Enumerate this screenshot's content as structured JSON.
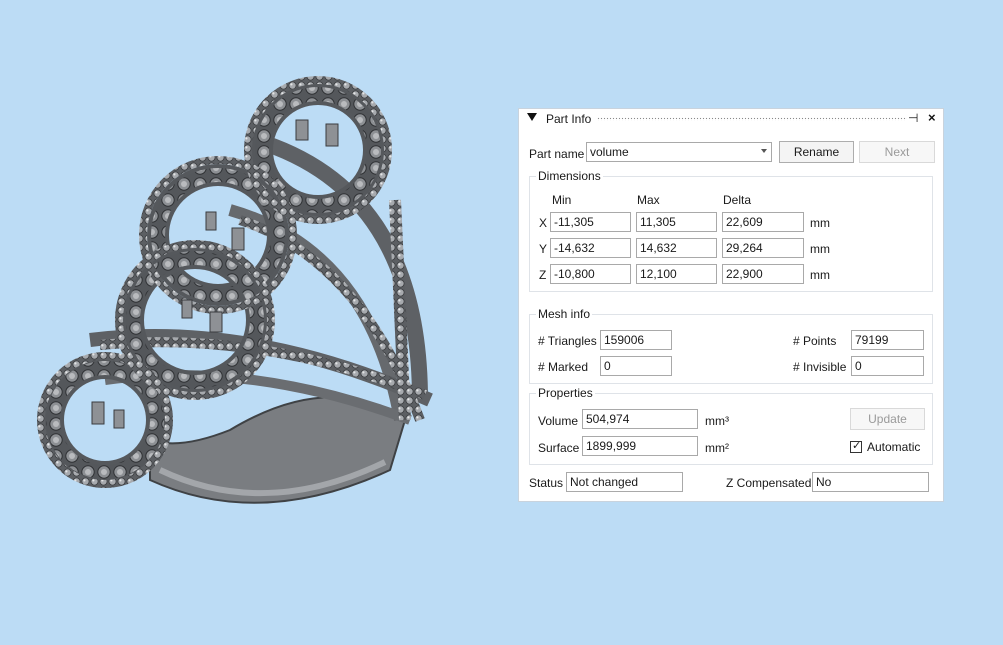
{
  "panel": {
    "title": "Part Info",
    "pin_glyph": "⊣",
    "close_glyph": "×"
  },
  "part": {
    "label": "Part name",
    "value": "volume",
    "rename": "Rename",
    "next": "Next"
  },
  "dimensions": {
    "title": "Dimensions",
    "headers": [
      "Min",
      "Max",
      "Delta"
    ],
    "unit": "mm",
    "rows": [
      {
        "axis": "X",
        "min": "-11,305",
        "max": "11,305",
        "delta": "22,609"
      },
      {
        "axis": "Y",
        "min": "-14,632",
        "max": "14,632",
        "delta": "29,264"
      },
      {
        "axis": "Z",
        "min": "-10,800",
        "max": "12,100",
        "delta": "22,900"
      }
    ]
  },
  "mesh": {
    "title": "Mesh info",
    "triangles_label": "# Triangles",
    "triangles": "159006",
    "points_label": "# Points",
    "points": "79199",
    "marked_label": "# Marked",
    "marked": "0",
    "invisible_label": "# Invisible",
    "invisible": "0"
  },
  "properties": {
    "title": "Properties",
    "volume_label": "Volume",
    "volume": "504,974",
    "volume_unit": "mm³",
    "surface_label": "Surface",
    "surface": "1899,999",
    "surface_unit": "mm²",
    "update": "Update",
    "automatic_label": "Automatic",
    "automatic_checked": true
  },
  "status": {
    "label": "Status",
    "value": "Not changed",
    "zcomp_label": "Z Compensated",
    "zcomp_value": "No"
  },
  "model": {
    "metal_color": "#6e7175",
    "background_color": "#bcdcf5"
  }
}
